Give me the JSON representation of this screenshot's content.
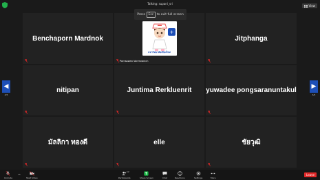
{
  "window": {
    "talking": "Talking: supani_sri",
    "view_label": "View"
  },
  "toast": {
    "press": "Press",
    "key": "Esc",
    "rest": "to exit full screen"
  },
  "tiles": [
    {
      "name": "Benchaporn Mardnok"
    },
    {
      "name": "Pornsawan Vonmvanich",
      "caption": "มหาวิทยาลัยเชียงใหม่"
    },
    {
      "name": "Jitphanga"
    },
    {
      "name": "nitipan"
    },
    {
      "name": "Juntima Rerkluenrit"
    },
    {
      "name": "yuwadee pongsaranuntakul"
    },
    {
      "name": "มัลลิกา ทองดี"
    },
    {
      "name": "elle"
    },
    {
      "name": "ชัยวุฒิ"
    }
  ],
  "nav": {
    "prev_page": "4/4",
    "next_page": "4/4"
  },
  "toolbar": {
    "unmute": "Unmute",
    "start_video": "Start Video",
    "participants": "Participants",
    "participants_count": "12",
    "share_screen": "Share Screen",
    "chat": "Chat",
    "reactions": "Reactions",
    "settings": "Settings",
    "more": "More",
    "leave": "Leave"
  },
  "colors": {
    "accent": "#1d4fb8",
    "share": "#1fbf4b",
    "leave": "#e02828",
    "tile_bg": "#222222"
  }
}
